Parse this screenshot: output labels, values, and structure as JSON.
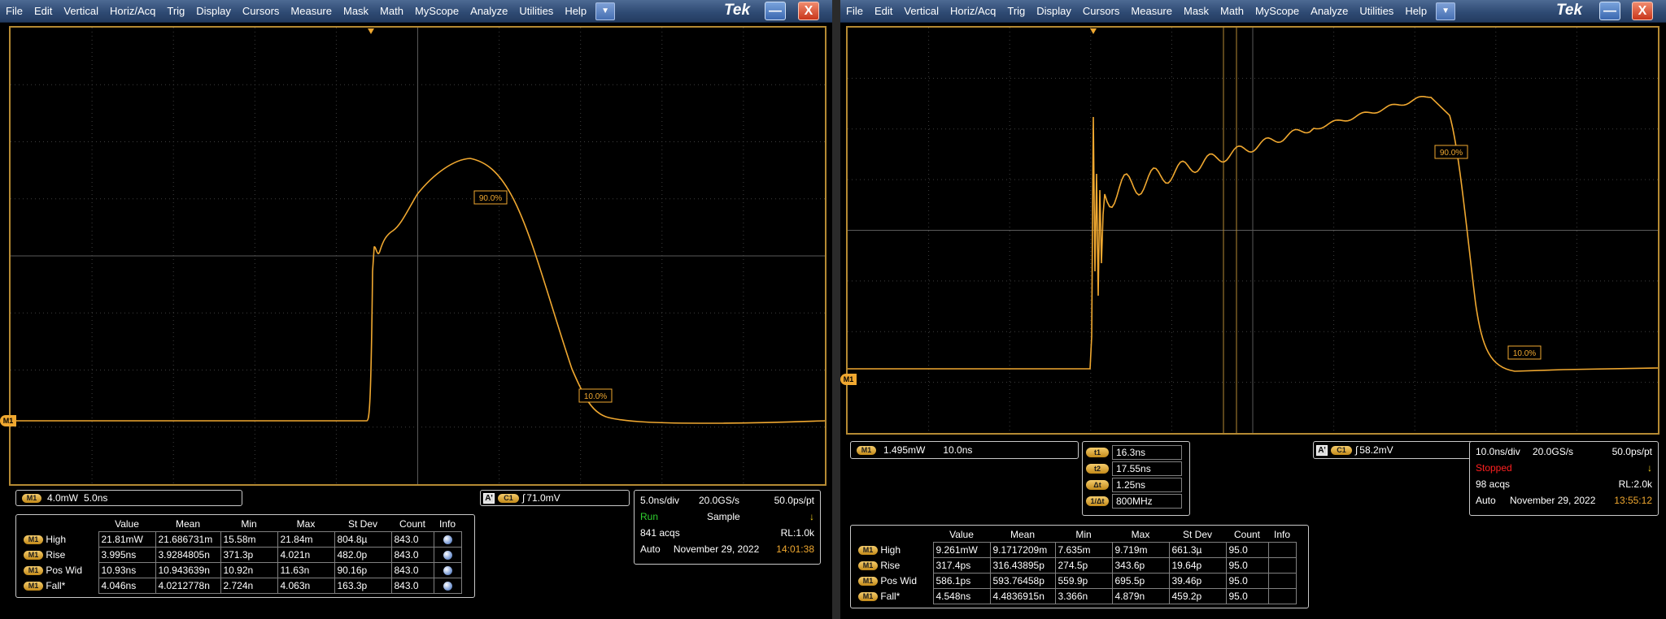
{
  "menu": [
    "File",
    "Edit",
    "Vertical",
    "Horiz/Acq",
    "Trig",
    "Display",
    "Cursors",
    "Measure",
    "Mask",
    "Math",
    "MyScope",
    "Analyze",
    "Utilities",
    "Help"
  ],
  "menu_dropdown_glyph": "▼",
  "brand": "Tek",
  "window": {
    "minimize": "—",
    "close": "X"
  },
  "trace_color": "#f0a830",
  "left": {
    "ref_marker": "M1",
    "markers": [
      "90.0%",
      "10.0%"
    ],
    "channel_scale": {
      "tag": "M1",
      "scale": "4.0mW",
      "timebase": "5.0ns"
    },
    "trigger": {
      "a": "A'",
      "ch": "C1",
      "slope": "∫",
      "level": "71.0mV"
    },
    "acq": {
      "timebase": "5.0ns/div",
      "sample_rate": "20.0GS/s",
      "resolution": "50.0ps/pt",
      "state": "Run",
      "mode": "Sample",
      "acqs": "841 acqs",
      "record_length": "RL:1.0k",
      "trigger_mode": "Auto",
      "date": "November 29, 2022",
      "time": "14:01:38"
    },
    "meas_headers": [
      "Value",
      "Mean",
      "Min",
      "Max",
      "St Dev",
      "Count",
      "Info"
    ],
    "meas_rows": [
      {
        "tag": "M1",
        "name": "High",
        "cells": [
          "21.81mW",
          "21.686731m",
          "15.58m",
          "21.84m",
          "804.8µ",
          "843.0"
        ]
      },
      {
        "tag": "M1",
        "name": "Rise",
        "cells": [
          "3.995ns",
          "3.9284805n",
          "371.3p",
          "4.021n",
          "482.0p",
          "843.0"
        ]
      },
      {
        "tag": "M1",
        "name": "Pos Wid",
        "cells": [
          "10.93ns",
          "10.943639n",
          "10.92n",
          "11.63n",
          "90.16p",
          "843.0"
        ]
      },
      {
        "tag": "M1",
        "name": "Fall*",
        "cells": [
          "4.046ns",
          "4.0212778n",
          "2.724n",
          "4.063n",
          "163.3p",
          "843.0"
        ]
      }
    ]
  },
  "right": {
    "ref_marker": "M1",
    "markers": [
      "90.0%",
      "10.0%"
    ],
    "channel_scale": {
      "tag": "M1",
      "scale": "1.495mW",
      "timebase": "10.0ns"
    },
    "cursors": [
      {
        "tag": "t1",
        "value": "16.3ns"
      },
      {
        "tag": "t2",
        "value": "17.55ns"
      },
      {
        "tag": "Δt",
        "value": "1.25ns"
      },
      {
        "tag": "1/Δt",
        "value": "800MHz"
      }
    ],
    "trigger": {
      "a": "A'",
      "ch": "C1",
      "slope": "∫",
      "level": "58.2mV"
    },
    "acq": {
      "timebase": "10.0ns/div",
      "sample_rate": "20.0GS/s",
      "resolution": "50.0ps/pt",
      "state": "Stopped",
      "acqs": "98 acqs",
      "record_length": "RL:2.0k",
      "trigger_mode": "Auto",
      "date": "November 29, 2022",
      "time": "13:55:12"
    },
    "meas_headers": [
      "Value",
      "Mean",
      "Min",
      "Max",
      "St Dev",
      "Count",
      "Info"
    ],
    "meas_rows": [
      {
        "tag": "M1",
        "name": "High",
        "cells": [
          "9.261mW",
          "9.1717209m",
          "7.635m",
          "9.719m",
          "661.3µ",
          "95.0"
        ]
      },
      {
        "tag": "M1",
        "name": "Rise",
        "cells": [
          "317.4ps",
          "316.43895p",
          "274.5p",
          "343.6p",
          "19.64p",
          "95.0"
        ]
      },
      {
        "tag": "M1",
        "name": "Pos Wid",
        "cells": [
          "586.1ps",
          "593.76458p",
          "559.9p",
          "695.5p",
          "39.46p",
          "95.0"
        ]
      },
      {
        "tag": "M1",
        "name": "Fall*",
        "cells": [
          "4.548ns",
          "4.4836915n",
          "3.366n",
          "4.879n",
          "459.2p",
          "95.0"
        ]
      }
    ]
  }
}
